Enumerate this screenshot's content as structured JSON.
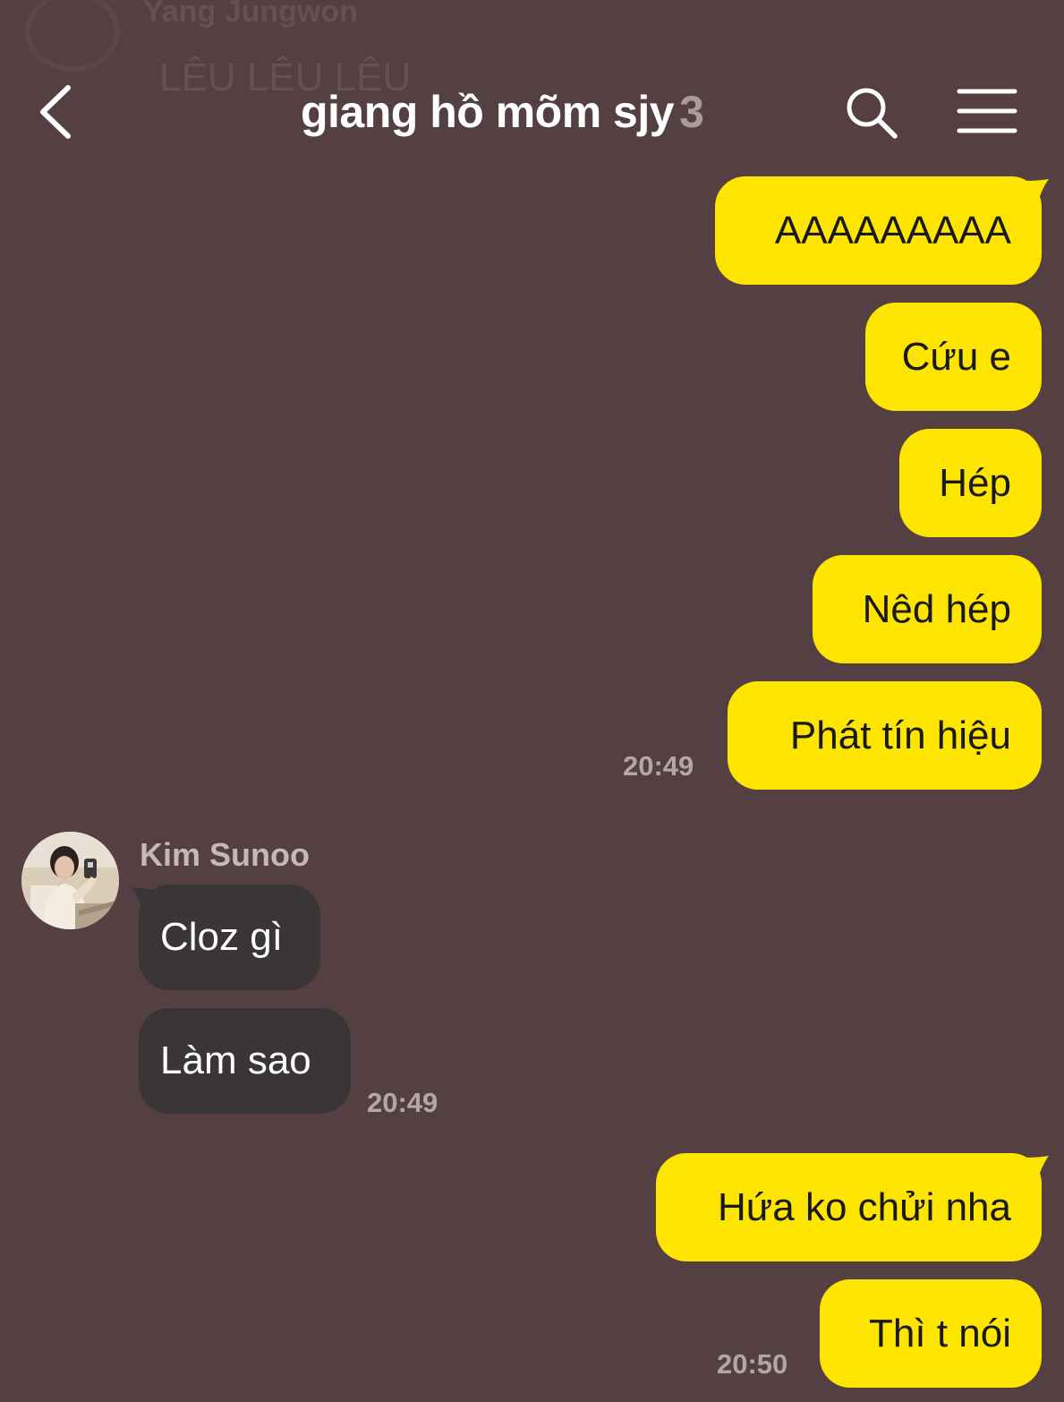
{
  "ghost": {
    "name": "Yang Jungwon",
    "message": "LÊU LÊU LÊU"
  },
  "header": {
    "title": "giang hồ mõm sjy",
    "member_count": "3",
    "icons": {
      "back": "chevron-left-icon",
      "search": "search-icon",
      "menu": "hamburger-menu-icon"
    }
  },
  "colors": {
    "background": "#544042",
    "my_bubble": "#fee500",
    "their_bubble": "#3a3637"
  },
  "messages": {
    "m1": "AAAAAAAAA",
    "m2": "Cứu e",
    "m3": "Hép",
    "m4": "Nêd hép",
    "m5": "Phát tín hiệu",
    "time1": "20:49",
    "sender": "Kim Sunoo",
    "r1": "Cloz gì",
    "r2": "Làm sao",
    "time2": "20:49",
    "m6": "Hứa ko chửi nha",
    "m7": "Thì t nói",
    "time3": "20:50"
  }
}
